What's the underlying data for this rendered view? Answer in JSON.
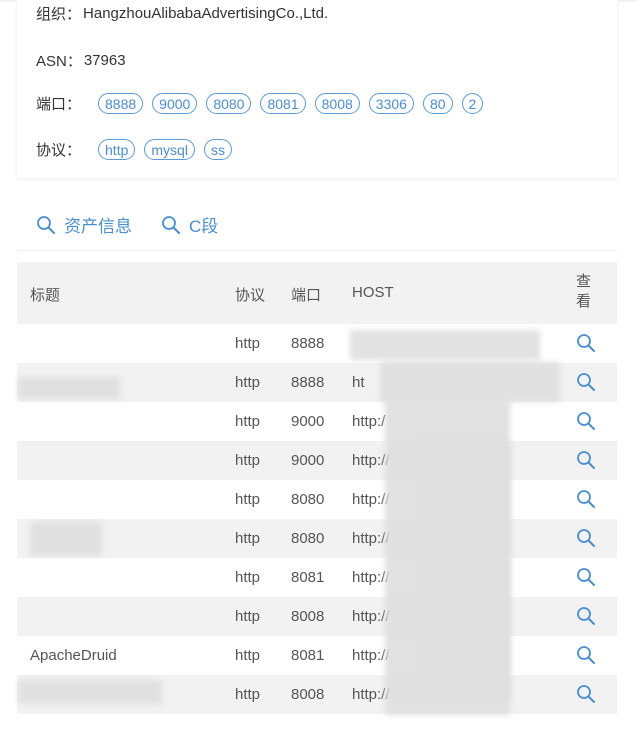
{
  "info": {
    "org_label": "组织：",
    "org_value": "HangzhouAlibabaAdvertisingCo.,Ltd.",
    "asn_label": "ASN：",
    "asn_value": "37963",
    "port_label": "端口：",
    "ports": [
      "8888",
      "9000",
      "8080",
      "8081",
      "8008",
      "3306",
      "80",
      "2"
    ],
    "proto_label": "协议：",
    "protocols": [
      "http",
      "mysql",
      "ss"
    ]
  },
  "tabs": {
    "assets": "资产信息",
    "cseg": "C段"
  },
  "table": {
    "headers": {
      "title": "标题",
      "protocol": "协议",
      "port": "端口",
      "host": "HOST",
      "view": "查看"
    },
    "rows": [
      {
        "title": "",
        "protocol": "http",
        "port": "8888",
        "host": ""
      },
      {
        "title": "",
        "protocol": "http",
        "port": "8888",
        "host": "ht"
      },
      {
        "title": "",
        "protocol": "http",
        "port": "9000",
        "host": "http:/"
      },
      {
        "title": "",
        "protocol": "http",
        "port": "9000",
        "host": "http://"
      },
      {
        "title": "",
        "protocol": "http",
        "port": "8080",
        "host": "http://"
      },
      {
        "title": "",
        "protocol": "http",
        "port": "8080",
        "host": "http://"
      },
      {
        "title": "",
        "protocol": "http",
        "port": "8081",
        "host": "http://"
      },
      {
        "title": "",
        "protocol": "http",
        "port": "8008",
        "host": "http://"
      },
      {
        "title": "ApacheDruid",
        "protocol": "http",
        "port": "8081",
        "host": "http://"
      },
      {
        "title": "",
        "protocol": "http",
        "port": "8008",
        "host": "http://"
      }
    ]
  },
  "colors": {
    "accent": "#4a8ed0",
    "row_alt": "#f2f2f2"
  }
}
